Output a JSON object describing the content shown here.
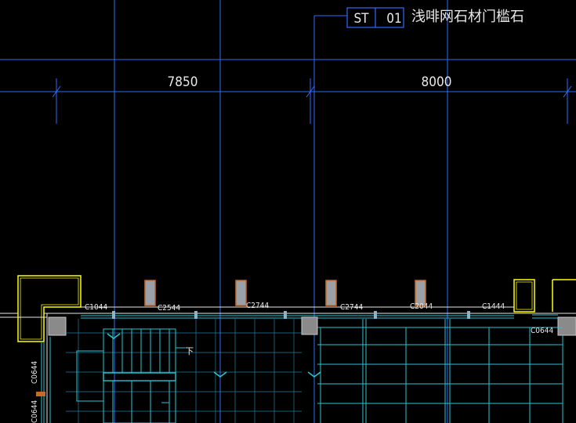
{
  "tag": {
    "code": "ST",
    "number": "01",
    "description": "浅啡网石材门槛石"
  },
  "dimensions": [
    {
      "value": "7850"
    },
    {
      "value": "8000"
    }
  ],
  "openings": [
    {
      "label": "C1044"
    },
    {
      "label": "C2544"
    },
    {
      "label": "C2744"
    },
    {
      "label": "C2744"
    },
    {
      "label": "C2044"
    },
    {
      "label": "C1444"
    },
    {
      "label": "C0644"
    },
    {
      "label": "C0644"
    },
    {
      "label": "C0644"
    }
  ],
  "stair_label": "下",
  "colors": {
    "background": "#000000",
    "axis": "#2f6cff",
    "wall": "#e8e8e8",
    "window": "#26c6d0",
    "yellow": "#ffff00",
    "column": "#8a8a8a",
    "column_fill": "#9aa0a6",
    "column_edge": "#c66a2a",
    "grid": "#2fa6d0"
  }
}
